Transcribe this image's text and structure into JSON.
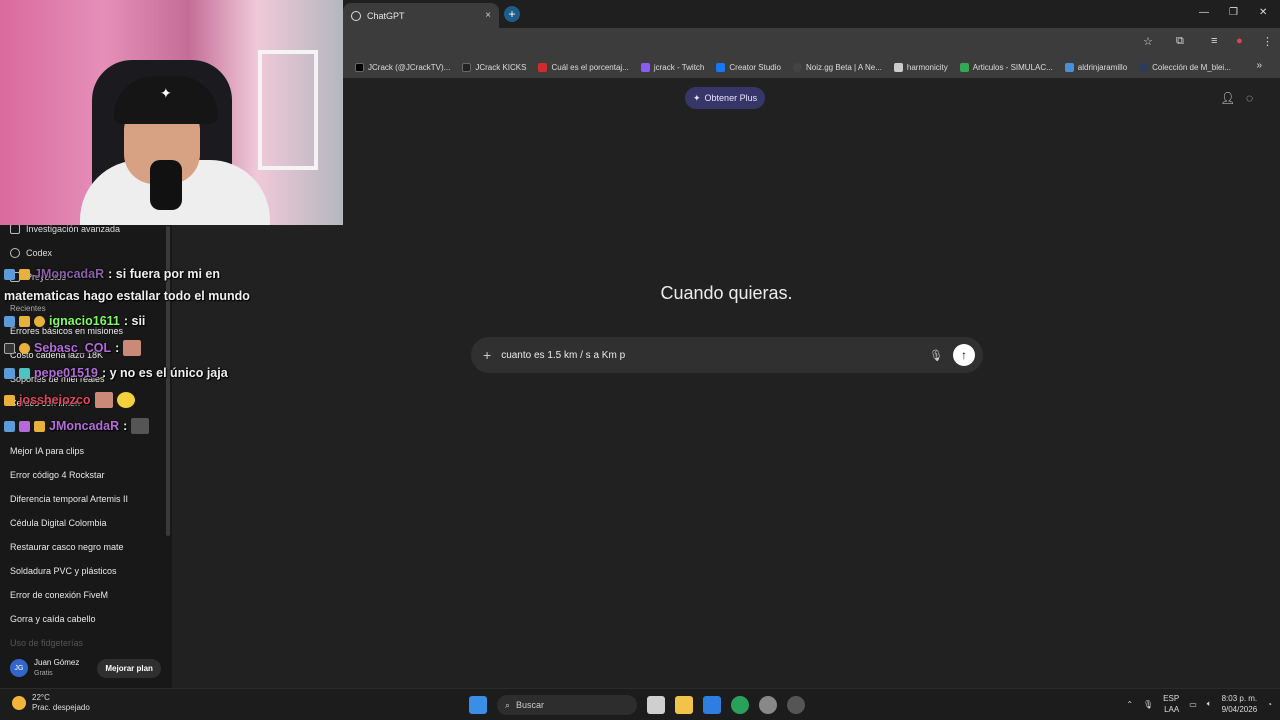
{
  "browser": {
    "tab_title": "ChatGPT",
    "tab_close": "×",
    "new_tab": "+",
    "window_controls": [
      "—",
      "❐",
      "✕"
    ],
    "bookmarks": [
      {
        "label": "JCrack (@JCrackTV)...",
        "color": "#000000"
      },
      {
        "label": "JCrack KICKS",
        "color": "#222222"
      },
      {
        "label": "Cuál es el porcentaj...",
        "color": "#d12b2b"
      },
      {
        "label": "jcrack - Twitch",
        "color": "#8a5cf6"
      },
      {
        "label": "Creator Studio",
        "color": "#1877f2"
      },
      {
        "label": "Noiz.gg Beta | A Ne...",
        "color": "#444444"
      },
      {
        "label": "harmonicity",
        "color": "#cccccc"
      },
      {
        "label": "Articulos - SIMULAC...",
        "color": "#34a853"
      },
      {
        "label": "aldrinjaramillo",
        "color": "#4a90d9"
      },
      {
        "label": "Colección de M_blei...",
        "color": "#2b3b5a"
      }
    ],
    "bookmarks_more": "»"
  },
  "chatgpt": {
    "get_plus": "Obtener Plus",
    "headline": "Cuando quieras.",
    "composer_text": "cuanto es 1.5 km / s a Km p",
    "sidebar": {
      "top_items": [
        {
          "label": "Investigación avanzada",
          "icon": "telescope-icon"
        },
        {
          "label": "Codex",
          "icon": "codex-icon"
        },
        {
          "label": "Proyectos",
          "icon": "folder-icon"
        }
      ],
      "recents_label": "Recientes",
      "recents": [
        "Errores básicos en misiones",
        "Costo cadena lazo 18K",
        "Soportes de miel reales",
        "Cerdos con limón",
        "Mejor IA para clips",
        "Error código 4 Rockstar",
        "Diferencia temporal Artemis II",
        "Cédula Digital Colombia",
        "Restaurar casco negro mate",
        "Soldadura PVC y plásticos",
        "Error de conexión FiveM",
        "Gorra y caída cabello",
        "Uso de fidgeterías"
      ],
      "user": {
        "initials": "JG",
        "name": "Juan Gómez",
        "plan": "Gratis",
        "upgrade": "Mejorar plan"
      }
    }
  },
  "stream_chat": [
    {
      "user": "JMoncadaR",
      "color": "#b46bd9",
      "text": ": si fuera por mi en"
    },
    {
      "user": "",
      "color": "#ffffff",
      "text": "matematicas hago estallar todo el mundo"
    },
    {
      "user": "ignacio1611",
      "color": "#7cfc64",
      "text": ": sii"
    },
    {
      "user": "Sebasc_COL",
      "color": "#b46bd9",
      "text": ":"
    },
    {
      "user": "pepe01519",
      "color": "#b46bd9",
      "text": ": y no es el único jaja"
    },
    {
      "user": "jossheiozco",
      "color": "#e0445a",
      "text": ""
    },
    {
      "user": "JMoncadaR",
      "color": "#b46bd9",
      "text": ":"
    }
  ],
  "taskbar": {
    "weather_temp": "22°C",
    "weather_desc": "Prac. despejado",
    "search_placeholder": "Buscar",
    "lang": "ESP",
    "lang2": "LAA",
    "time": "8:03 p. m.",
    "date": "9/04/2026"
  }
}
